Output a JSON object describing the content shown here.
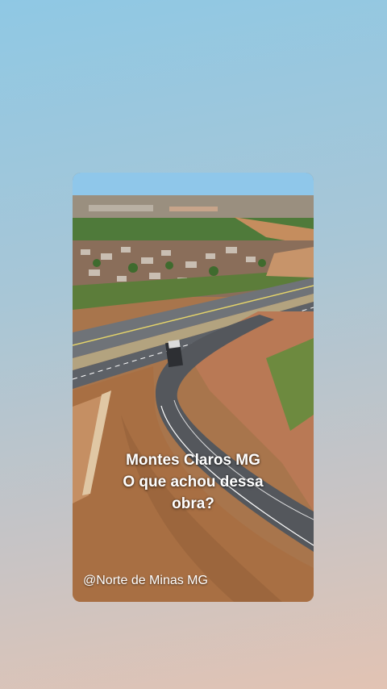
{
  "colors": {
    "background_top": "#8fc8e4",
    "background_bottom": "#e2c3b3",
    "caption_text": "#ffffff"
  },
  "post": {
    "caption_line1": "Montes Claros MG",
    "caption_line2": "O que achou dessa",
    "caption_line3": "obra?",
    "watermark": "@Norte de Minas MG"
  }
}
